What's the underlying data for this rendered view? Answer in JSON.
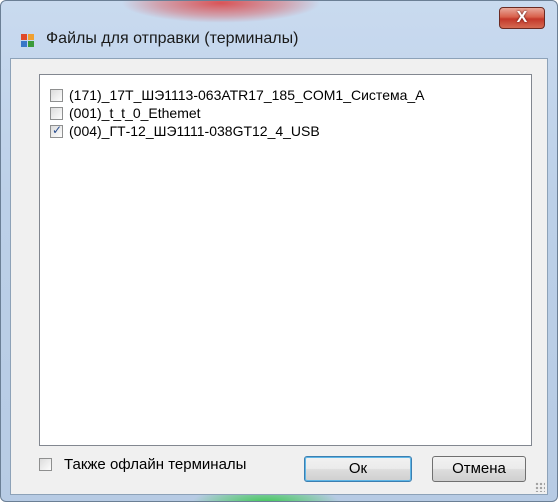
{
  "window": {
    "title": "Файлы для отправки (терминалы)",
    "close_symbol": "X",
    "icon": "app-window-icon"
  },
  "terminals": [
    {
      "label": "(171)_17Т_ШЭ1113-063АТR17_185_COM1_Система_А",
      "checked": false
    },
    {
      "label": "(001)_t_t_0_Ethemet",
      "checked": false
    },
    {
      "label": "(004)_ГТ-12_ШЭ1111-038GT12_4_USB",
      "checked": true
    }
  ],
  "footer": {
    "offline_label": "Также офлайн терминалы",
    "offline_checked": false,
    "ok_label": "Ок",
    "cancel_label": "Отмена"
  },
  "colors": {
    "close_button": "#c4382a",
    "check_mark": "#2a4d8e",
    "window_frame": "#bcd0e8"
  }
}
